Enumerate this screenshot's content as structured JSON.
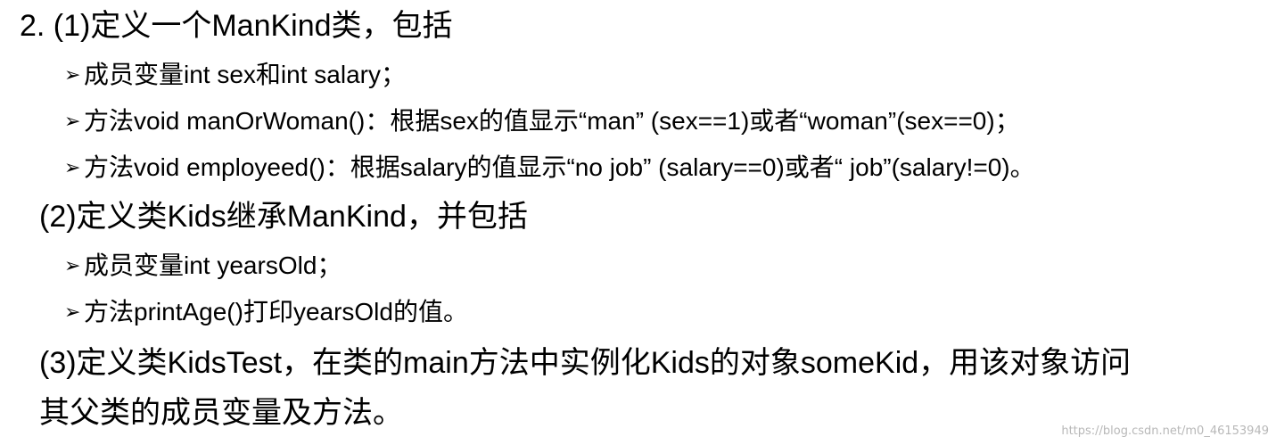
{
  "doc": {
    "lines": [
      "2. (1)定义一个ManKind类，包括",
      "成员变量int sex和int salary；",
      "方法void manOrWoman()：根据sex的值显示“man” (sex==1)或者“woman”(sex==0)；",
      "方法void employeed()：根据salary的值显示“no job” (salary==0)或者“ job”(salary!=0)。",
      "(2)定义类Kids继承ManKind，并包括",
      "成员变量int yearsOld；",
      "方法printAge()打印yearsOld的值。",
      "(3)定义类KidsTest，在类的main方法中实例化Kids的对象someKid，用该对象访问",
      "其父类的成员变量及方法。"
    ],
    "bullet_symbol": "➢",
    "watermark": "https://blog.csdn.net/m0_46153949"
  }
}
